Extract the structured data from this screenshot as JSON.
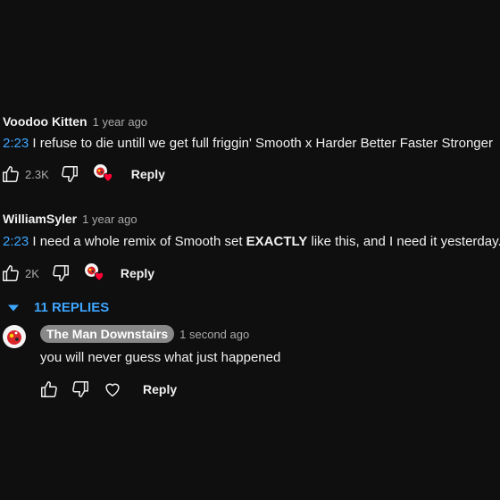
{
  "comments": [
    {
      "author": "Voodoo Kitten",
      "time": "1 year ago",
      "timestamp": "2:23",
      "text": " I refuse to die untill we get full friggin' Smooth x Harder Better Faster Stronger",
      "likes": "2.3K",
      "reply_label": "Reply"
    },
    {
      "author": "WilliamSyler",
      "time": "1 year ago",
      "timestamp": "2:23",
      "text_before": " I need a whole remix of Smooth set ",
      "text_bold": "EXACTLY",
      "text_after": " like this, and I need it yesterday.",
      "likes": "2K",
      "reply_label": "Reply"
    }
  ],
  "replies_toggle": {
    "label": "11 REPLIES"
  },
  "reply": {
    "author": "The Man Downstairs",
    "time": "1 second ago",
    "text": "you will never guess what just happened",
    "reply_label": "Reply"
  },
  "colors": {
    "background": "#0f0f0f",
    "link": "#3ea6ff",
    "heart": "#ff0033",
    "author_chip": "#888888"
  },
  "icons": [
    "like-icon",
    "dislike-icon",
    "creator-heart-icon",
    "heart-outline-icon",
    "chevron-down-icon"
  ]
}
